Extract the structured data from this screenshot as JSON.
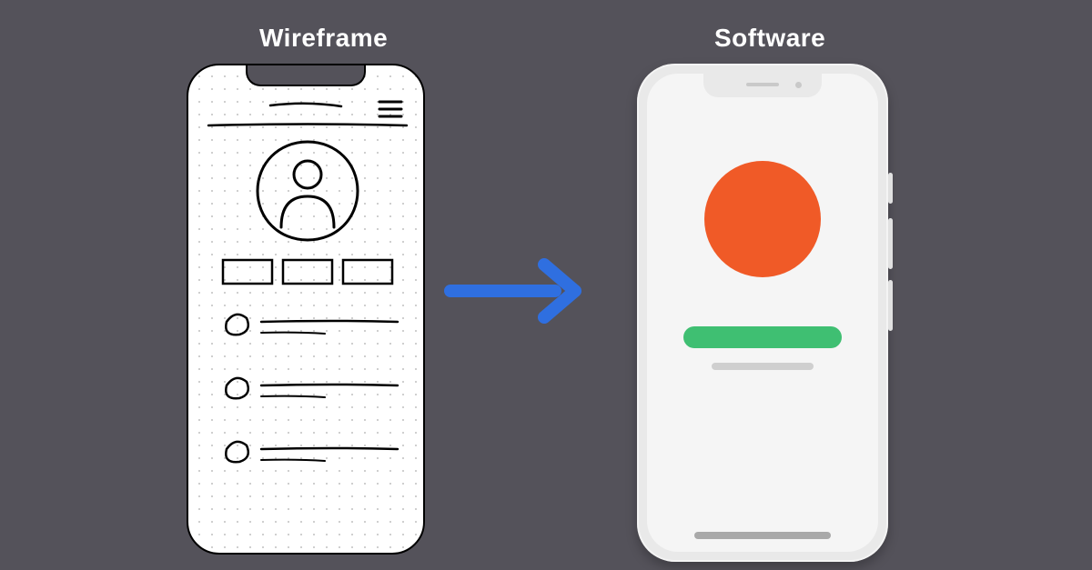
{
  "headings": {
    "left": "Wireframe",
    "right": "Software"
  },
  "colors": {
    "background": "#54525a",
    "arrow": "#2f6fe0",
    "circle": "#f05a27",
    "pill": "#3fbf72",
    "softwarePhone": "#e9e9e9",
    "softwareScreen": "#f5f5f5"
  },
  "wireframe": {
    "hamburger_lines": 3,
    "tabs": 3,
    "list_items": 3
  }
}
